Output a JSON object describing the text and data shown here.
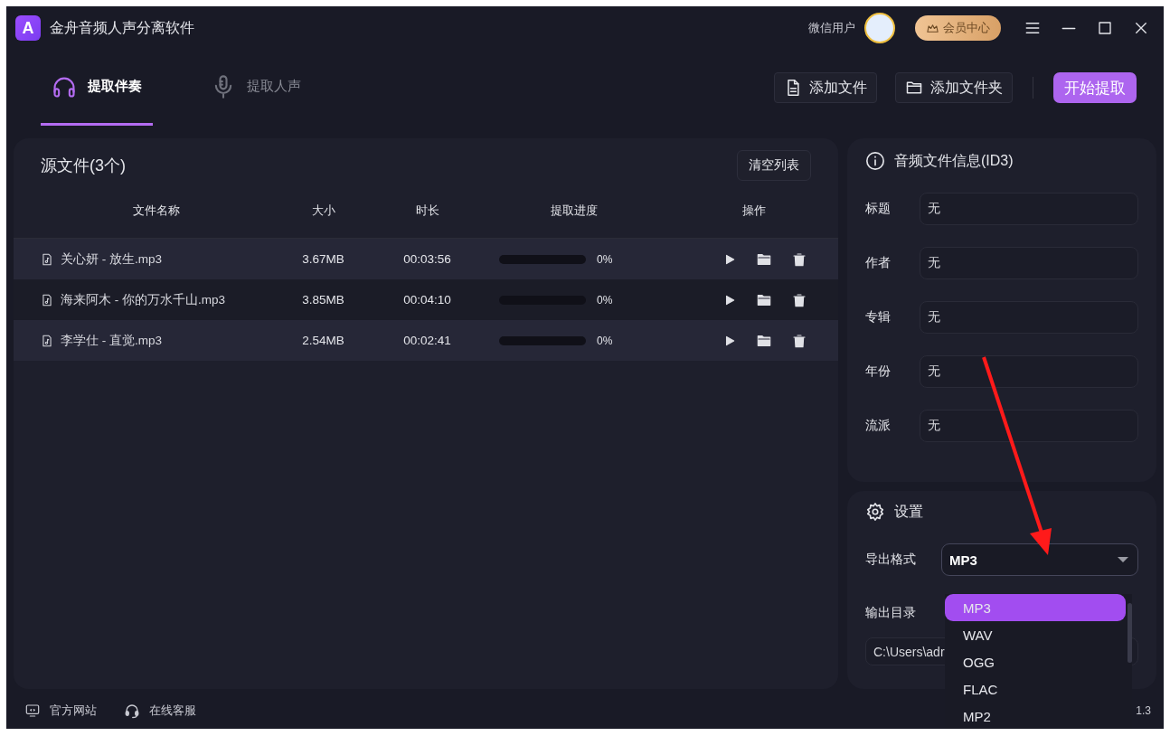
{
  "app": {
    "logo_text": "A",
    "title": "金舟音频人声分离软件"
  },
  "user": {
    "name": "微信用户"
  },
  "vip_button": "会员中心",
  "tabs": [
    {
      "label": "提取伴奏",
      "selected": true,
      "kind": "headphones"
    },
    {
      "label": "提取人声",
      "selected": false,
      "kind": "mic"
    }
  ],
  "toolbar": {
    "add_file": "添加文件",
    "add_folder": "添加文件夹",
    "start": "开始提取"
  },
  "file_list": {
    "title": "源文件(3个)",
    "clear_button": "清空列表",
    "columns": [
      "文件名称",
      "大小",
      "时长",
      "提取进度",
      "操作"
    ],
    "rows": [
      {
        "name": "关心妍 - 放生.mp3",
        "size": "3.67MB",
        "duration": "00:03:56",
        "level": 0,
        "progress": "0%"
      },
      {
        "name": "海来阿木 - 你的万水千山.mp3",
        "size": "3.85MB",
        "duration": "00:04:10",
        "level": 0,
        "progress": "0%"
      },
      {
        "name": "李学仕 - 直觉.mp3",
        "size": "2.54MB",
        "duration": "00:02:41",
        "level": 0,
        "progress": "0%"
      }
    ]
  },
  "id3_panel": {
    "title": "音频文件信息(ID3)",
    "fields": [
      {
        "label": "标题",
        "value": "无"
      },
      {
        "label": "作者",
        "value": "无"
      },
      {
        "label": "专辑",
        "value": "无"
      },
      {
        "label": "年份",
        "value": "无"
      },
      {
        "label": "流派",
        "value": "无"
      }
    ]
  },
  "settings": {
    "title": "设置",
    "format_label": "导出格式",
    "format_value": "MP3",
    "expanded": true,
    "format_options": [
      {
        "label": "MP3",
        "selected": true
      },
      {
        "label": "WAV",
        "selected": false
      },
      {
        "label": "OGG",
        "selected": false
      },
      {
        "label": "FLAC",
        "selected": false
      },
      {
        "label": "MP2",
        "selected": false
      }
    ],
    "output_label": "输出目录",
    "output_path": "C:\\Users\\adr"
  },
  "footer": {
    "links": [
      {
        "label": "官方网站",
        "kind": "monitor"
      },
      {
        "label": "在线客服",
        "kind": "headset"
      }
    ],
    "version": "1.3"
  }
}
